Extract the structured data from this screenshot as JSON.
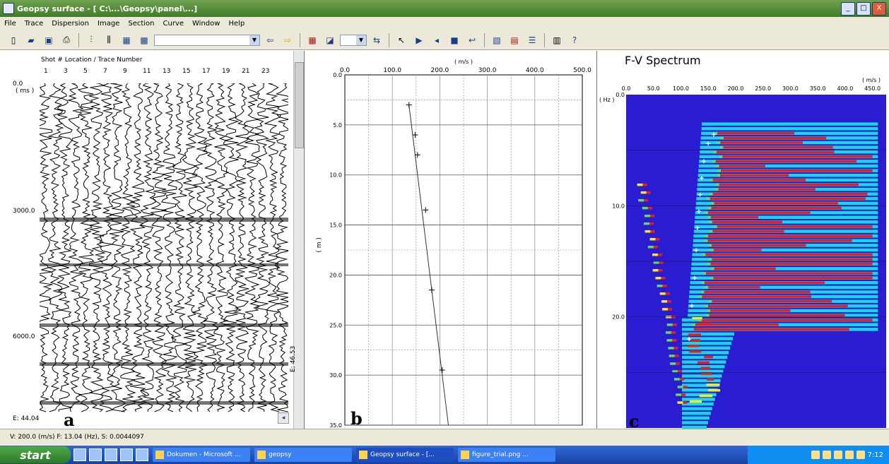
{
  "window": {
    "title": "Geopsy surface - [ C:\\...\\Geopsy\\panel\\...]",
    "buttons": [
      "_",
      "□",
      "X"
    ]
  },
  "menu": [
    "File",
    "Trace",
    "Dispersion",
    "Image",
    "Section",
    "Curve",
    "Window",
    "Help"
  ],
  "toolbar": {
    "combo_value": "",
    "small_combo_value": ""
  },
  "panel_a": {
    "header": "Shot # Location / Trace Number",
    "tick_labels": [
      "1",
      "3",
      "5",
      "7",
      "9",
      "11",
      "13",
      "15",
      "17",
      "19",
      "21",
      "23"
    ],
    "y_ticks": [
      "0.0",
      "3000.0",
      "6000.0"
    ],
    "y_unit": "( ms )",
    "letter": "a",
    "corner_label": "E: 44.04",
    "side_label": "E: 46.53"
  },
  "panel_b": {
    "x_unit": "( m/s )",
    "x_ticks": [
      "0.0",
      "100.0",
      "200.0",
      "300.0",
      "400.0",
      "500.0"
    ],
    "y_ticks": [
      "0.0",
      "5.0",
      "10.0",
      "15.0",
      "20.0",
      "25.0",
      "30.0",
      "35.0"
    ],
    "y_unit": "( m )",
    "letter": "b",
    "points": [
      {
        "v": 135,
        "d": 3.0
      },
      {
        "v": 148,
        "d": 6.0
      },
      {
        "v": 153,
        "d": 8.0
      },
      {
        "v": 170,
        "d": 13.5
      },
      {
        "v": 183,
        "d": 21.5
      },
      {
        "v": 205,
        "d": 29.5
      }
    ]
  },
  "panel_c": {
    "title": "F-V Spectrum",
    "x_unit": "( m/s )",
    "x_ticks": [
      "0.0",
      "50.0",
      "100.0",
      "150.0",
      "200.0",
      "250.0",
      "300.0",
      "350.0",
      "400.0",
      "450.0"
    ],
    "y_unit": "( Hz )",
    "y_ticks": [
      "0.0",
      "10.0",
      "20.0"
    ],
    "letter": "c",
    "colors": {
      "bg": "#2a1cd0",
      "cyan": "#19d6e6",
      "green": "#5fe05a",
      "red": "#e4201e",
      "yellow": "#f4e832"
    }
  },
  "status": {
    "text": "V: 200.0 (m/s) F: 13.04 (Hz), S: 0.0044097"
  },
  "taskbar": {
    "start": "start",
    "tasks": [
      "Dokumen - Microsoft ...",
      "geopsy",
      "Geopsy surface - [...",
      "figure_trial.png ..."
    ],
    "clock": "7:12"
  }
}
